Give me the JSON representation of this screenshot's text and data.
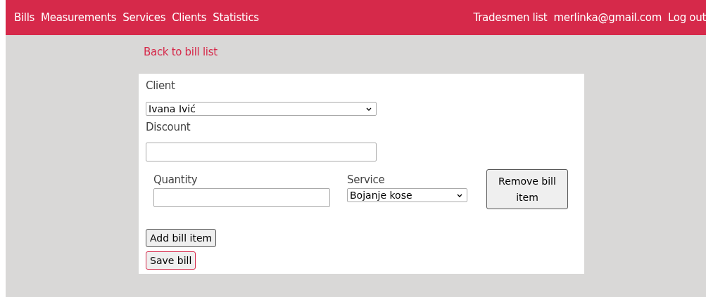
{
  "nav": {
    "left": [
      "Bills",
      "Measurements",
      "Services",
      "Clients",
      "Statistics"
    ],
    "right": [
      "Tradesmen list",
      "merlinka@gmail.com",
      "Log out"
    ]
  },
  "back_link": "Back to bill list",
  "form": {
    "client_label": "Client",
    "client_value": "Ivana Ivić",
    "discount_label": "Discount",
    "items": [
      {
        "quantity_label": "Quantity",
        "service_label": "Service",
        "service_value": "Bojanje kose",
        "remove_button": "Remove bill item"
      }
    ],
    "add_button": "Add bill item",
    "save_button": "Save bill"
  }
}
